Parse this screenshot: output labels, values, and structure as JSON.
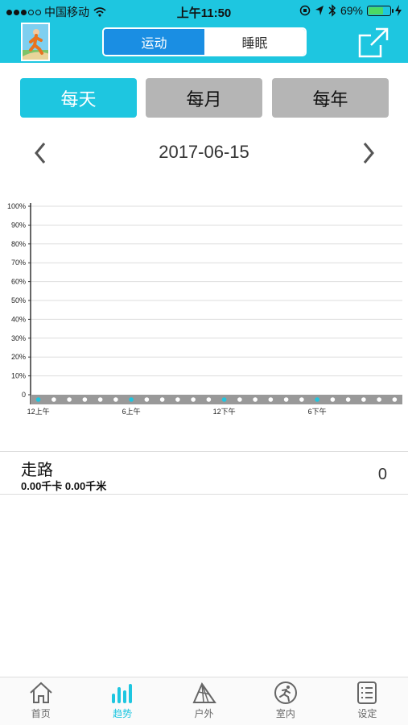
{
  "status_bar": {
    "carrier": "中国移动",
    "time": "上午11:50",
    "battery": "69%",
    "battery_level": 0.69
  },
  "header": {
    "segments": [
      "运动",
      "睡眠"
    ],
    "active_segment": "运动"
  },
  "period_tabs": [
    "每天",
    "每月",
    "每年"
  ],
  "active_period": "每天",
  "date": "2017-06-15",
  "chart_data": {
    "type": "bar",
    "y_tick_labels": [
      "100%",
      "90%",
      "80%",
      "70%",
      "60%",
      "50%",
      "40%",
      "30%",
      "20%",
      "10%",
      "0"
    ],
    "x_tick_labels": [
      "12上午",
      "6上午",
      "12下午",
      "6下午"
    ],
    "ylim": [
      0,
      100
    ],
    "values": [
      0,
      0,
      0,
      0,
      0,
      0,
      0,
      0,
      0,
      0,
      0,
      0,
      0,
      0,
      0,
      0,
      0,
      0,
      0,
      0,
      0,
      0,
      0,
      0
    ],
    "grid": true,
    "colors": {
      "axis": "#333333",
      "grid": "#dddddd",
      "baseline": "#999999",
      "marker": "#1ec6e0"
    }
  },
  "activity": {
    "title": "走路",
    "subtitle": "0.00千卡 0.00千米",
    "count": "0"
  },
  "tabbar": {
    "items": [
      {
        "label": "首页",
        "icon": "home-icon"
      },
      {
        "label": "趋势",
        "icon": "trend-bars-icon"
      },
      {
        "label": "户外",
        "icon": "tent-icon"
      },
      {
        "label": "室内",
        "icon": "indoor-run-icon"
      },
      {
        "label": "设定",
        "icon": "settings-list-icon"
      }
    ],
    "selected": "趋势"
  },
  "colors": {
    "accent": "#1ec6e0",
    "segment_active": "#1a8ee3",
    "tab_inactive": "#b5b5b5"
  }
}
